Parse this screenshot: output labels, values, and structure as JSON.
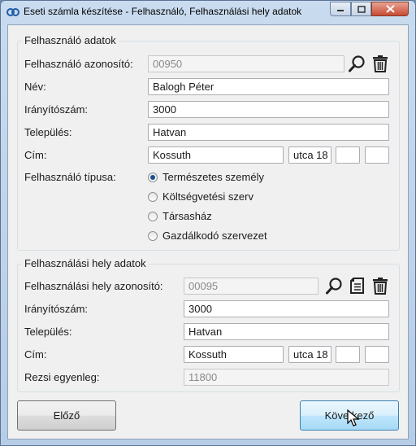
{
  "window": {
    "title": "Eseti számla készítése - Felhasználó, Felhasználási hely adatok"
  },
  "user_group": {
    "title": "Felhasználó adatok",
    "id_label": "Felhasználó azonosító:",
    "id_value": "00950",
    "name_label": "Név:",
    "name_value": "Balogh Péter",
    "zip_label": "Irányítószám:",
    "zip_value": "3000",
    "city_label": "Település:",
    "city_value": "Hatvan",
    "address_label": "Cím:",
    "street_value": "Kossuth",
    "street_type_value": "utca 18",
    "house_value": "",
    "extra_value": "",
    "type_label": "Felhasználó típusa:",
    "type_options": [
      {
        "label": "Természetes személy",
        "selected": true
      },
      {
        "label": "Költségvetési szerv",
        "selected": false
      },
      {
        "label": "Társasház",
        "selected": false
      },
      {
        "label": "Gazdálkodó szervezet",
        "selected": false
      }
    ]
  },
  "site_group": {
    "title": "Felhasználási hely adatok",
    "id_label": "Felhasználási hely azonosító:",
    "id_value": "00095",
    "zip_label": "Irányítószám:",
    "zip_value": "3000",
    "city_label": "Település:",
    "city_value": "Hatvan",
    "address_label": "Cím:",
    "street_value": "Kossuth",
    "street_type_value": "utca 18",
    "house_value": "",
    "extra_value": "",
    "balance_label": "Rezsi egyenleg:",
    "balance_value": "11800"
  },
  "buttons": {
    "prev_label": "Előző",
    "next_label": "Következő"
  },
  "icons": {
    "search": "search-icon",
    "delete": "trash-icon",
    "document": "document-icon"
  },
  "colors": {
    "radio_selected": "#1c4f8f",
    "titlebar": "#c9dbee",
    "close_button": "#c74a33"
  }
}
